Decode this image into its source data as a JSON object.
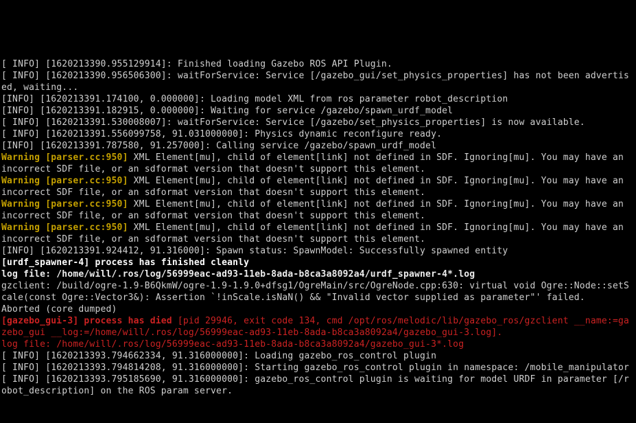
{
  "lines": {
    "l01": "[ INFO] [1620213390.955129914]: Finished loading Gazebo ROS API Plugin.",
    "l02": "[ INFO] [1620213390.956506300]: waitForService: Service [/gazebo_gui/set_physics_properties] has not been advertised, waiting...",
    "l03": "[INFO] [1620213391.174100, 0.000000]: Loading model XML from ros parameter robot_description",
    "l04": "[INFO] [1620213391.182915, 0.000000]: Waiting for service /gazebo/spawn_urdf_model",
    "l05": "[ INFO] [1620213391.530008007]: waitForService: Service [/gazebo/set_physics_properties] is now available.",
    "l06": "[ INFO] [1620213391.556099758, 91.031000000]: Physics dynamic reconfigure ready.",
    "l07": "[INFO] [1620213391.787580, 91.257000]: Calling service /gazebo/spawn_urdf_model",
    "warn_prefix": "Warning [parser.cc:950]",
    "warn_body": " XML Element[mu], child of element[link] not defined in SDF. Ignoring[mu]. You may have an incorrect SDF file, or an sdformat version that doesn't support this element.",
    "l12": "[INFO] [1620213391.924412, 91.316000]: Spawn status: SpawnModel: Successfully spawned entity",
    "l13": "[urdf_spawner-4] process has finished cleanly",
    "l14": "log file: /home/will/.ros/log/56999eac-ad93-11eb-8ada-b8ca3a8092a4/urdf_spawner-4*.log",
    "l15": "gzclient: /build/ogre-1.9-B6QkmW/ogre-1.9-1.9.0+dfsg1/OgreMain/src/OgreNode.cpp:630: virtual void Ogre::Node::setScale(const Ogre::Vector3&): Assertion `!inScale.isNaN() && \"Invalid vector supplied as parameter\"' failed.",
    "l16": "Aborted (core dumped)",
    "l17_a": "[gazebo_gui-3] process has died",
    "l17_b": " [pid 29946, exit code 134, cmd /opt/ros/melodic/lib/gazebo_ros/gzclient __name:=gazebo_gui __log:=/home/will/.ros/log/56999eac-ad93-11eb-8ada-b8ca3a8092a4/gazebo_gui-3.log].",
    "l18": "log file: /home/will/.ros/log/56999eac-ad93-11eb-8ada-b8ca3a8092a4/gazebo_gui-3*.log",
    "l19": "[ INFO] [1620213393.794662334, 91.316000000]: Loading gazebo_ros_control plugin",
    "l20": "[ INFO] [1620213393.794814208, 91.316000000]: Starting gazebo_ros_control plugin in namespace: /mobile_manipulator",
    "l21": "[ INFO] [1620213393.795185690, 91.316000000]: gazebo_ros_control plugin is waiting for model URDF in parameter [/robot_description] on the ROS param server."
  }
}
